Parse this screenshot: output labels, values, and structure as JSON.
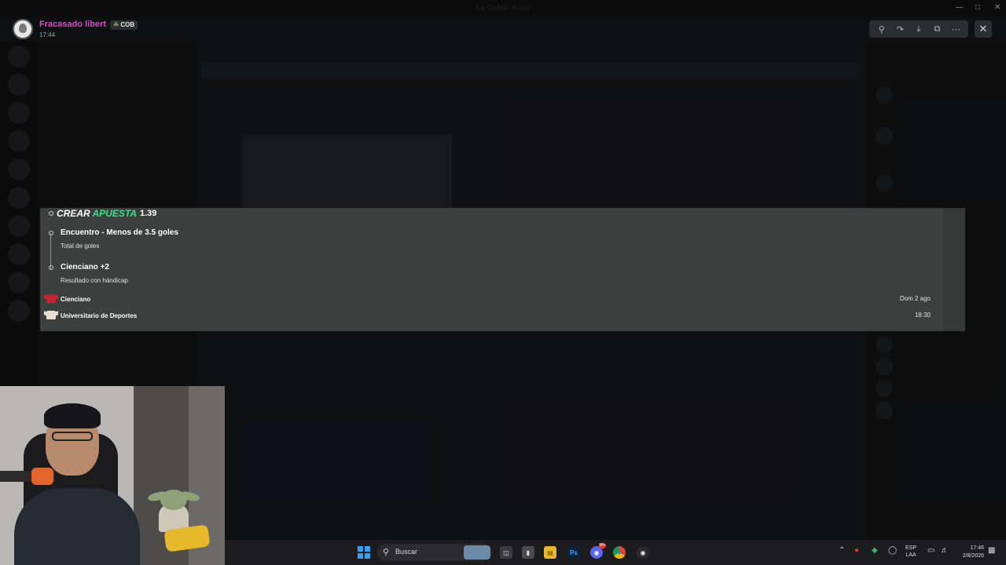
{
  "window": {
    "title": "La Goblin Army"
  },
  "viewer": {
    "user_name": "Fracasado libert...",
    "role_tag": "COB",
    "time": "17:44",
    "tools": [
      "zoom-in-icon",
      "forward-icon",
      "download-icon",
      "open-external-icon",
      "more-icon"
    ],
    "close_icon": "close-icon"
  },
  "bet": {
    "title_word1": "CREAR",
    "title_word2": "APUESTA",
    "odds": "1.39",
    "legs": [
      {
        "title": "Encuentro - Menos de 3.5 goles",
        "subtitle": "Total de goles"
      },
      {
        "title": "Cienciano +2",
        "subtitle": "Resultado con hándicap"
      }
    ],
    "home_team": "Cienciano",
    "away_team": "Universitario de Deportes",
    "date": "Dom 2 ago",
    "time": "18:30",
    "colors": {
      "accent": "#3ee08a",
      "card": "#3b3f3e",
      "home_jersey": "#c42331",
      "away_jersey": "#e9dfd2"
    }
  },
  "taskbar": {
    "search_placeholder": "Buscar",
    "apps": [
      "task-view-icon",
      "app-icon",
      "file-explorer-icon",
      "photoshop-icon",
      "discord-icon",
      "chrome-icon",
      "obs-icon"
    ],
    "discord_badge": "99+",
    "language_line1": "ESP",
    "language_line2": "LAA",
    "clock_time": "17:46",
    "clock_date": "2/8/2026"
  }
}
